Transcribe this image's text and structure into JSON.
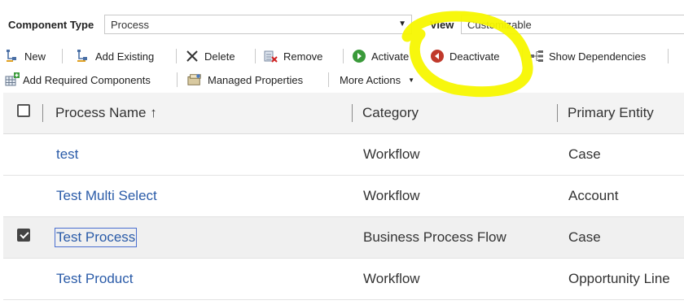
{
  "filter": {
    "component_type_label": "Component Type",
    "component_type_value": "Process",
    "view_label": "View",
    "view_value": "Customizable"
  },
  "toolbar": {
    "row1": [
      "New",
      "Add Existing",
      "Delete",
      "Remove",
      "Activate",
      "Deactivate",
      "Show Dependencies"
    ],
    "row2": [
      "Add Required Components",
      "Managed Properties",
      "More Actions"
    ]
  },
  "columns": [
    "Process Name ↑",
    "Category",
    "Primary Entity"
  ],
  "rows": [
    {
      "name": "test",
      "category": "Workflow",
      "entity": "Case",
      "checked": false
    },
    {
      "name": "Test Multi Select",
      "category": "Workflow",
      "entity": "Account",
      "checked": false
    },
    {
      "name": "Test Process",
      "category": "Business Process Flow",
      "entity": "Case",
      "checked": true
    },
    {
      "name": "Test Product",
      "category": "Workflow",
      "entity": "Opportunity Line",
      "checked": false
    }
  ],
  "colors": {
    "link": "#2a5ba8",
    "highlight": "#f7f700",
    "activate_icon": "#3a9a3a",
    "deactivate_icon": "#c0392b"
  }
}
